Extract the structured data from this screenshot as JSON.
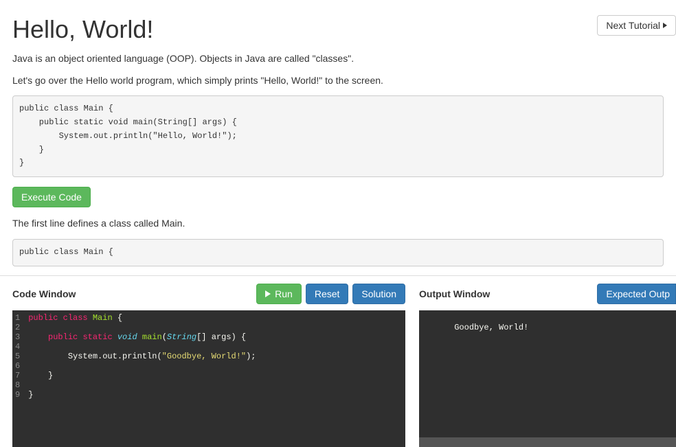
{
  "nav": {
    "next_label": "Next Tutorial"
  },
  "tutorial": {
    "title": "Hello, World!",
    "para1": "Java is an object oriented language (OOP). Objects in Java are called \"classes\".",
    "para2": "Let's go over the Hello world program, which simply prints \"Hello, World!\" to the screen.",
    "code1": "public class Main {\n    public static void main(String[] args) {\n        System.out.println(\"Hello, World!\");\n    }\n}",
    "execute_label": "Execute Code",
    "para3": "The first line defines a class called Main.",
    "code2": "public class Main {"
  },
  "codewin": {
    "title": "Code Window",
    "run_label": "Run",
    "reset_label": "Reset",
    "solution_label": "Solution",
    "line_count": 9,
    "tokens": [
      [
        [
          "public",
          "kw-red"
        ],
        [
          " ",
          "plain"
        ],
        [
          "class",
          "kw-red"
        ],
        [
          " ",
          "plain"
        ],
        [
          "Main",
          "cls-green"
        ],
        [
          " {",
          "plain"
        ]
      ],
      [],
      [
        [
          "    ",
          "plain"
        ],
        [
          "public",
          "kw-red"
        ],
        [
          " ",
          "plain"
        ],
        [
          "static",
          "kw-red"
        ],
        [
          " ",
          "plain"
        ],
        [
          "void",
          "kw-blue"
        ],
        [
          " ",
          "plain"
        ],
        [
          "main",
          "cls-green"
        ],
        [
          "(",
          "plain"
        ],
        [
          "String",
          "kw-blue"
        ],
        [
          "[] ",
          "plain"
        ],
        [
          "args",
          "plain"
        ],
        [
          ") {",
          "plain"
        ]
      ],
      [],
      [
        [
          "        ",
          "plain"
        ],
        [
          "System",
          "plain"
        ],
        [
          ".",
          "plain"
        ],
        [
          "out",
          "plain"
        ],
        [
          ".",
          "plain"
        ],
        [
          "println",
          "plain"
        ],
        [
          "(",
          "plain"
        ],
        [
          "\"Goodbye, World!\"",
          "str-yellow"
        ],
        [
          ");",
          "plain"
        ]
      ],
      [],
      [
        [
          "    }",
          "plain"
        ]
      ],
      [],
      [
        [
          "}",
          "plain"
        ]
      ]
    ]
  },
  "outputwin": {
    "title": "Output Window",
    "expected_label": "Expected Outp",
    "text": "Goodbye, World!"
  }
}
